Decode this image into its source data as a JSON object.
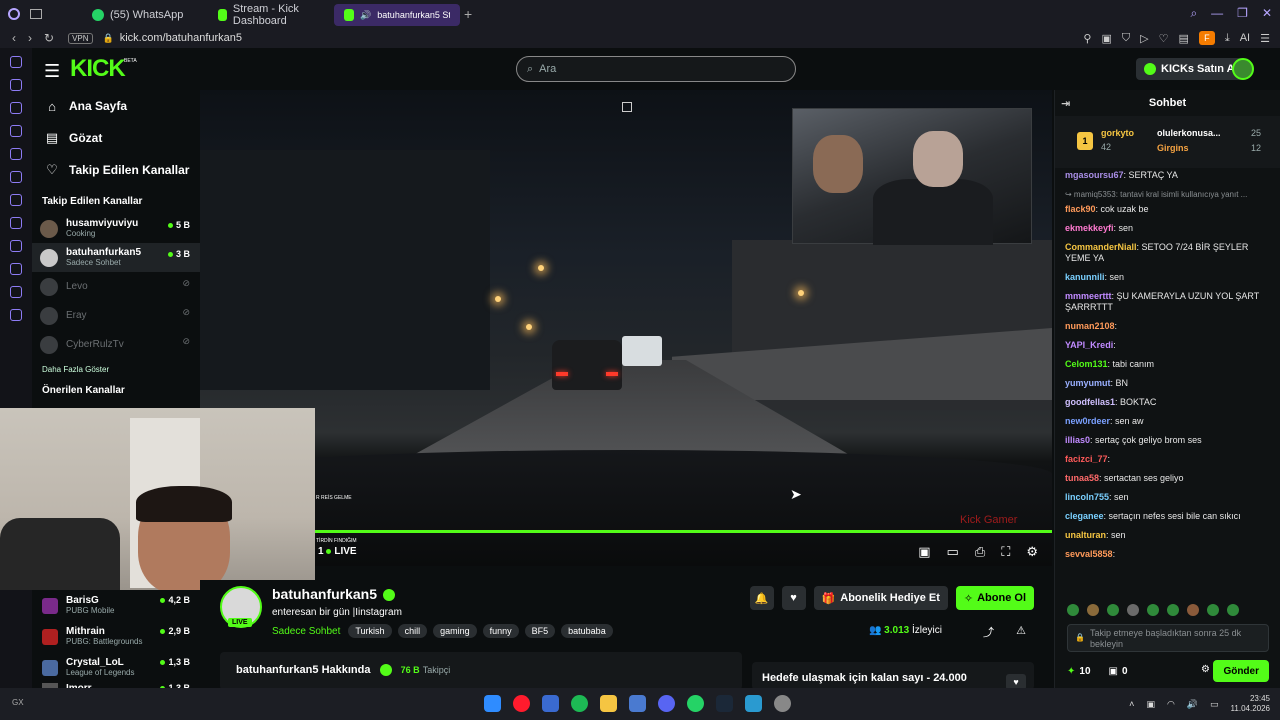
{
  "browser": {
    "tabs": [
      {
        "label": "(55) WhatsApp",
        "icon": "whatsapp-icon",
        "active": false
      },
      {
        "label": "Stream - Kick Dashboard",
        "icon": "kick-icon",
        "active": false
      },
      {
        "label": "batuhanfurkan5 Strea",
        "icon": "kick-icon",
        "active": true
      }
    ],
    "url": "kick.com/batuhanfurkan5",
    "vpn_label": "VPN",
    "ai_label": "AI"
  },
  "header": {
    "logo": "KICK",
    "beta": "BETA",
    "search_placeholder": "Ara",
    "kicks_button": "KICKs Satın Al"
  },
  "sidebar": {
    "nav": [
      {
        "label": "Ana Sayfa",
        "icon": "home-icon"
      },
      {
        "label": "Gözat",
        "icon": "browse-icon"
      },
      {
        "label": "Takip Edilen Kanallar",
        "icon": "heart-icon"
      }
    ],
    "followed_heading": "Takip Edilen Kanallar",
    "followed": [
      {
        "name": "husamviyuviyu",
        "sub": "Cooking",
        "viewers": "5 B",
        "live": true
      },
      {
        "name": "batuhanfurkan5",
        "sub": "Sadece Sohbet",
        "viewers": "3 B",
        "live": true
      },
      {
        "name": "Levo",
        "sub": "",
        "viewers": "",
        "live": false
      },
      {
        "name": "Eray",
        "sub": "",
        "viewers": "",
        "live": false
      },
      {
        "name": "CyberRulzTv",
        "sub": "",
        "viewers": "",
        "live": false
      }
    ],
    "show_more": "Daha Fazla Göster",
    "recommended_heading": "Önerilen Kanallar",
    "recommended": [
      {
        "name": "BarisG",
        "sub": "PUBG Mobile",
        "viewers": "4,2 B"
      },
      {
        "name": "Mithrain",
        "sub": "PUBG: Battlegrounds",
        "viewers": "2,9 B"
      },
      {
        "name": "Crystal_LoL",
        "sub": "League of Legends",
        "viewers": "1,3 B"
      },
      {
        "name": "Imorr",
        "sub": "",
        "viewers": "1,3 B"
      }
    ]
  },
  "player": {
    "live_label": "LIVE",
    "live_count": "1",
    "overlay_text_1": "R REİS GELME",
    "overlay_text_2": "TİRDİN FINDIĞIM",
    "watermark": "Kick Gamer"
  },
  "stream": {
    "streamer": "batuhanfurkan5",
    "live_tag": "LIVE",
    "title": "enteresan bir gün |Iinstagram",
    "category": "Sadece Sohbet",
    "tags": [
      "Turkish",
      "chill",
      "gaming",
      "funny",
      "BF5",
      "batubaba"
    ],
    "gift_button": "Abonelik Hediye Et",
    "subscribe_button": "Abone Ol",
    "viewers": "3.013",
    "viewers_label": "İzleyici",
    "about_title": "batuhanfurkan5 Hakkında",
    "followers": "76 B",
    "followers_label": "Takipçi",
    "goal_text": "Hedefe ulaşmak için kalan sayı - 24.000"
  },
  "chat": {
    "title": "Sohbet",
    "pinned": {
      "rank": "1",
      "user1": "gorkyto",
      "user1_count": "42",
      "user2": "olulerkonusa...",
      "user2_count": "25",
      "user3": "Girgins",
      "user3_count": "12"
    },
    "messages": [
      {
        "user": "mgasoursu67",
        "text": ": SERTAÇ YA",
        "color": "#a98ee6"
      },
      {
        "reply": "↪ mamiq5353: tantavi kral isimli kullanıcıya yanıt ..."
      },
      {
        "user": "flack90",
        "text": ": cok uzak be",
        "color": "#ff9a5a"
      },
      {
        "user": "ekmekkeyfi",
        "text": ": sen",
        "color": "#ff7ad0"
      },
      {
        "user": "CommanderNiall",
        "text": ": SETOO 7/24 BİR ŞEYLER YEME YA",
        "color": "#f5c542"
      },
      {
        "user": "kanunnili",
        "text": ": sen",
        "color": "#7ad0ff"
      },
      {
        "user": "mmmeerttt",
        "text": ": ŞU KAMERAYLA UZUN YOL ŞART ŞARRRTTT",
        "color": "#c08aff"
      },
      {
        "user": "numan2108",
        "text": ":",
        "color": "#ff9a5a"
      },
      {
        "user": "YAPI_Kredi",
        "text": ":",
        "color": "#c08aff"
      },
      {
        "user": "Celom131",
        "text": ": tabi canım",
        "color": "#53fc18"
      },
      {
        "user": "yumyumut",
        "text": ": BN",
        "color": "#9ab0ff"
      },
      {
        "user": "goodfellas1",
        "text": ": BOKTAC",
        "color": "#d0c0ff"
      },
      {
        "user": "new0rdeer",
        "text": ": sen aw",
        "color": "#7aa0ff"
      },
      {
        "user": "illias0",
        "text": ": sertaç çok geliyo brom ses",
        "color": "#c08aff"
      },
      {
        "user": "facizci_77",
        "text": ":",
        "color": "#ff5a5a"
      },
      {
        "user": "tunaa58",
        "text": ": sertactan ses geliyo",
        "color": "#ff6a6a"
      },
      {
        "user": "lincoln755",
        "text": ": sen",
        "color": "#7ad0ff"
      },
      {
        "user": "cleganee",
        "text": ": sertaçın nefes sesi bile can sıkıcı",
        "color": "#7ad0ff"
      },
      {
        "user": "unalturan",
        "text": ": sen",
        "color": "#f5c542"
      },
      {
        "user": "sevval5858",
        "text": ":",
        "color": "#ff9a5a"
      }
    ],
    "input_placeholder": "Takip etmeye başladıktan sonra 25 dk bekleyin",
    "points": "10",
    "count": "0",
    "send_button": "Gönder"
  },
  "taskbar": {
    "time": "23:45",
    "date": "11.04.2026"
  }
}
